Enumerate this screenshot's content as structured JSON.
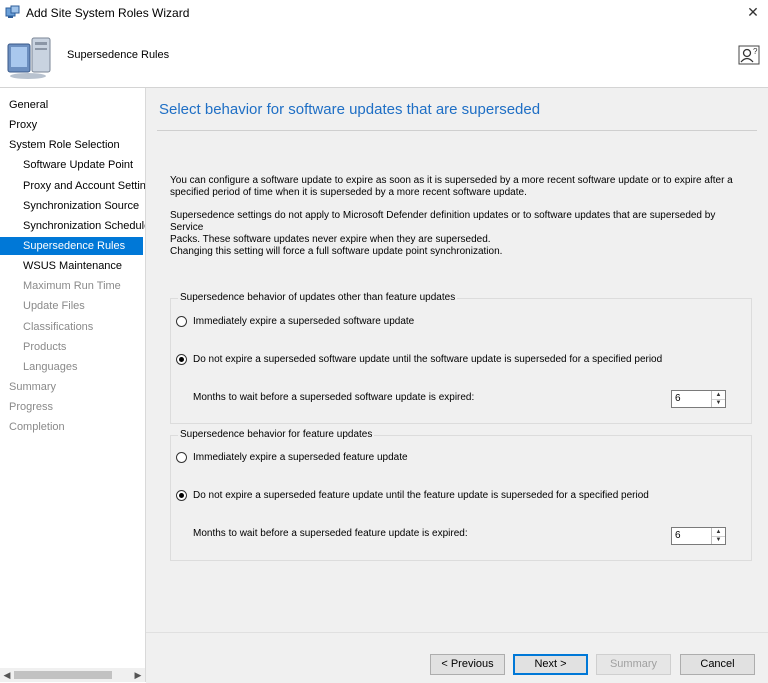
{
  "window": {
    "title": "Add Site System Roles Wizard",
    "close_glyph": "✕"
  },
  "header": {
    "page_title": "Supersedence Rules"
  },
  "nav": {
    "items": [
      {
        "label": "General",
        "state": "normal"
      },
      {
        "label": "Proxy",
        "state": "normal"
      },
      {
        "label": "System Role Selection",
        "state": "normal"
      },
      {
        "label": "Software Update Point",
        "state": "normal"
      },
      {
        "label": "Proxy and Account Settin",
        "state": "normal"
      },
      {
        "label": "Synchronization Source",
        "state": "normal"
      },
      {
        "label": "Synchronization Schedule",
        "state": "normal"
      },
      {
        "label": "Supersedence Rules",
        "state": "selected"
      },
      {
        "label": "WSUS Maintenance",
        "state": "normal"
      },
      {
        "label": "Maximum Run Time",
        "state": "dim"
      },
      {
        "label": "Update Files",
        "state": "dim"
      },
      {
        "label": "Classifications",
        "state": "dim"
      },
      {
        "label": "Products",
        "state": "dim"
      },
      {
        "label": "Languages",
        "state": "dim"
      },
      {
        "label": "Summary",
        "state": "dim"
      },
      {
        "label": "Progress",
        "state": "dim"
      },
      {
        "label": "Completion",
        "state": "dim"
      }
    ],
    "scroll_left": "◀",
    "scroll_right": "▶"
  },
  "content": {
    "title": "Select behavior for software updates that are superseded",
    "para1_line1": "You can configure a software update to expire as soon as it is superseded by a more recent software update or to expire after a",
    "para1_line2": "specified period of time when it is superseded by a more recent software update.",
    "para2_line1": "Supersedence settings do not apply to Microsoft Defender definition updates or to software updates that are superseded by Service",
    "para2_line2": "Packs. These software updates never expire when they are superseded.",
    "para3": "Changing this setting will force a full software update point synchronization.",
    "group1": {
      "label": "Supersedence behavior of updates other than feature updates",
      "option1": "Immediately expire a superseded software update",
      "option2": "Do not expire a superseded software update until the software update is superseded for a specified period",
      "selected": 2,
      "months_label": "Months to wait before a superseded software update is expired:",
      "months_value": "6"
    },
    "group2": {
      "label": "Supersedence behavior for feature updates",
      "option1": "Immediately expire a superseded feature update",
      "option2": "Do not expire a superseded feature update until the feature update is superseded for a specified period",
      "selected": 2,
      "months_label": "Months to wait before a superseded feature update is expired:",
      "months_value": "6"
    }
  },
  "buttons": {
    "previous": "< Previous",
    "next": "Next >",
    "summary": "Summary",
    "cancel": "Cancel"
  },
  "colors": {
    "accent": "#0078d7",
    "title_blue": "#1f6fc5",
    "panel_bg": "#f0f0f0"
  },
  "icons": {
    "app": "wizard-app-icon",
    "header": "computer-icon",
    "help": "user-help-icon"
  }
}
